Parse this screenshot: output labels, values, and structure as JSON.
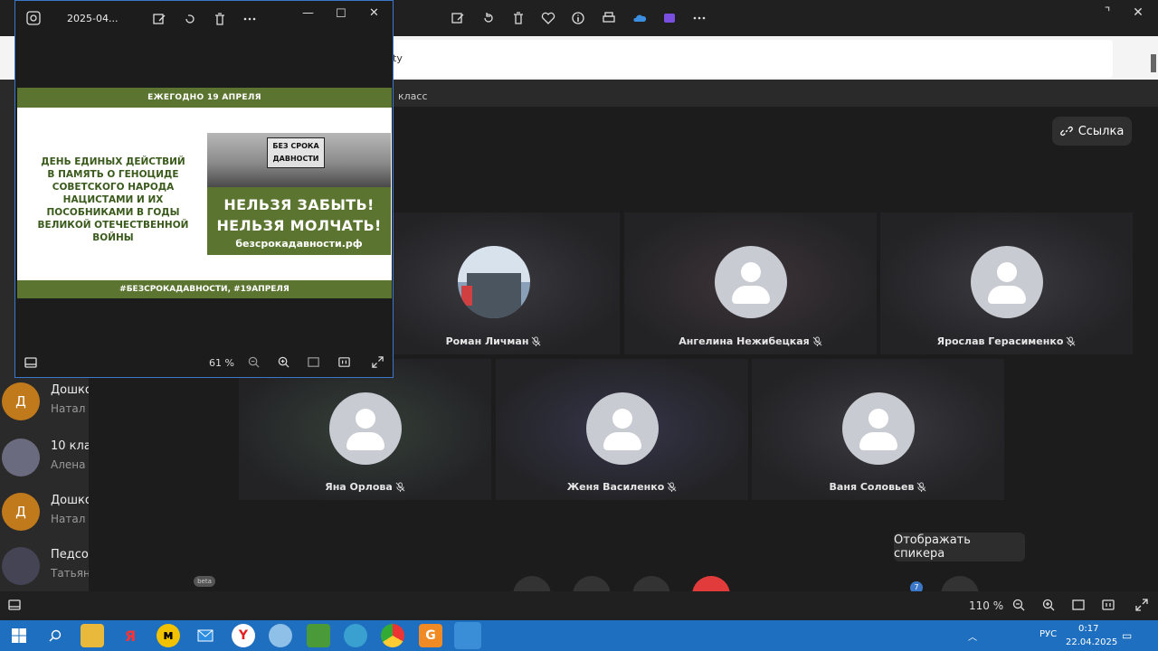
{
  "viewer": {
    "title": "2025-04...",
    "zoom": "61 %"
  },
  "poster": {
    "top_banner": "ЕЖЕГОДНО 19 АПРЕЛЯ",
    "text_lines": [
      "ДЕНЬ ЕДИНЫХ ДЕЙСТВИЙ",
      "В ПАМЯТЬ О ГЕНОЦИДЕ",
      "СОВЕТСКОГО НАРОДА",
      "НАЦИСТАМИ И ИХ",
      "ПОСОБНИКАМИ В ГОДЫ",
      "ВЕЛИКОЙ ОТЕЧЕСТВЕННОЙ ВОЙНЫ"
    ],
    "stamp_line1": "БЕЗ СРОКА",
    "stamp_line2": "ДАВНОСТИ",
    "slogan1": "НЕЛЬЗЯ ЗАБЫТЬ!",
    "slogan2": "НЕЛЬЗЯ МОЛЧАТЬ!",
    "site": "безсрокадавности.рф",
    "bottom_banner": "#БЕЗСРОКАДАВНОСТИ, #19АПРЕЛЯ"
  },
  "browser": {
    "url_fragment": "ty",
    "breadcrumb": "класс"
  },
  "chats": [
    {
      "avatar_letter": "Д",
      "avatar_color": "#c07a1c",
      "name": "Дошко",
      "sub": "Натал"
    },
    {
      "avatar_letter": "",
      "avatar_color": "#6b6b80",
      "name": "10 кла",
      "sub": "Алена"
    },
    {
      "avatar_letter": "Д",
      "avatar_color": "#c07a1c",
      "name": "Дошко",
      "sub": "Натал"
    },
    {
      "avatar_letter": "",
      "avatar_color": "#445",
      "name": "Педсо",
      "sub": "Татьян"
    }
  ],
  "meeting": {
    "link_label": "Ссылка",
    "participants_row1": [
      {
        "name": "Роман Личман",
        "photo": true
      },
      {
        "name": "Ангелина Нежибецкая",
        "photo": false
      },
      {
        "name": "Ярослав Герасименко",
        "photo": false
      }
    ],
    "participants_row2": [
      {
        "name": "Яна Орлова",
        "photo": false
      },
      {
        "name": "Женя Василенко",
        "photo": false
      },
      {
        "name": "Ваня Соловьев",
        "photo": false
      }
    ],
    "tooltip": "Отображать спикера",
    "beta_badge": "beta",
    "count_badge": "7"
  },
  "zoom_bar": {
    "zoom": "110 %"
  },
  "taskbar": {
    "lang": "РУС",
    "time": "0:17",
    "date": "22.04.2025"
  },
  "colors": {
    "poster_green": "#5b7530",
    "end_call_red": "#e23b3b",
    "taskbar_blue": "#1e6fbf",
    "accent_blue": "#3b78c9"
  }
}
